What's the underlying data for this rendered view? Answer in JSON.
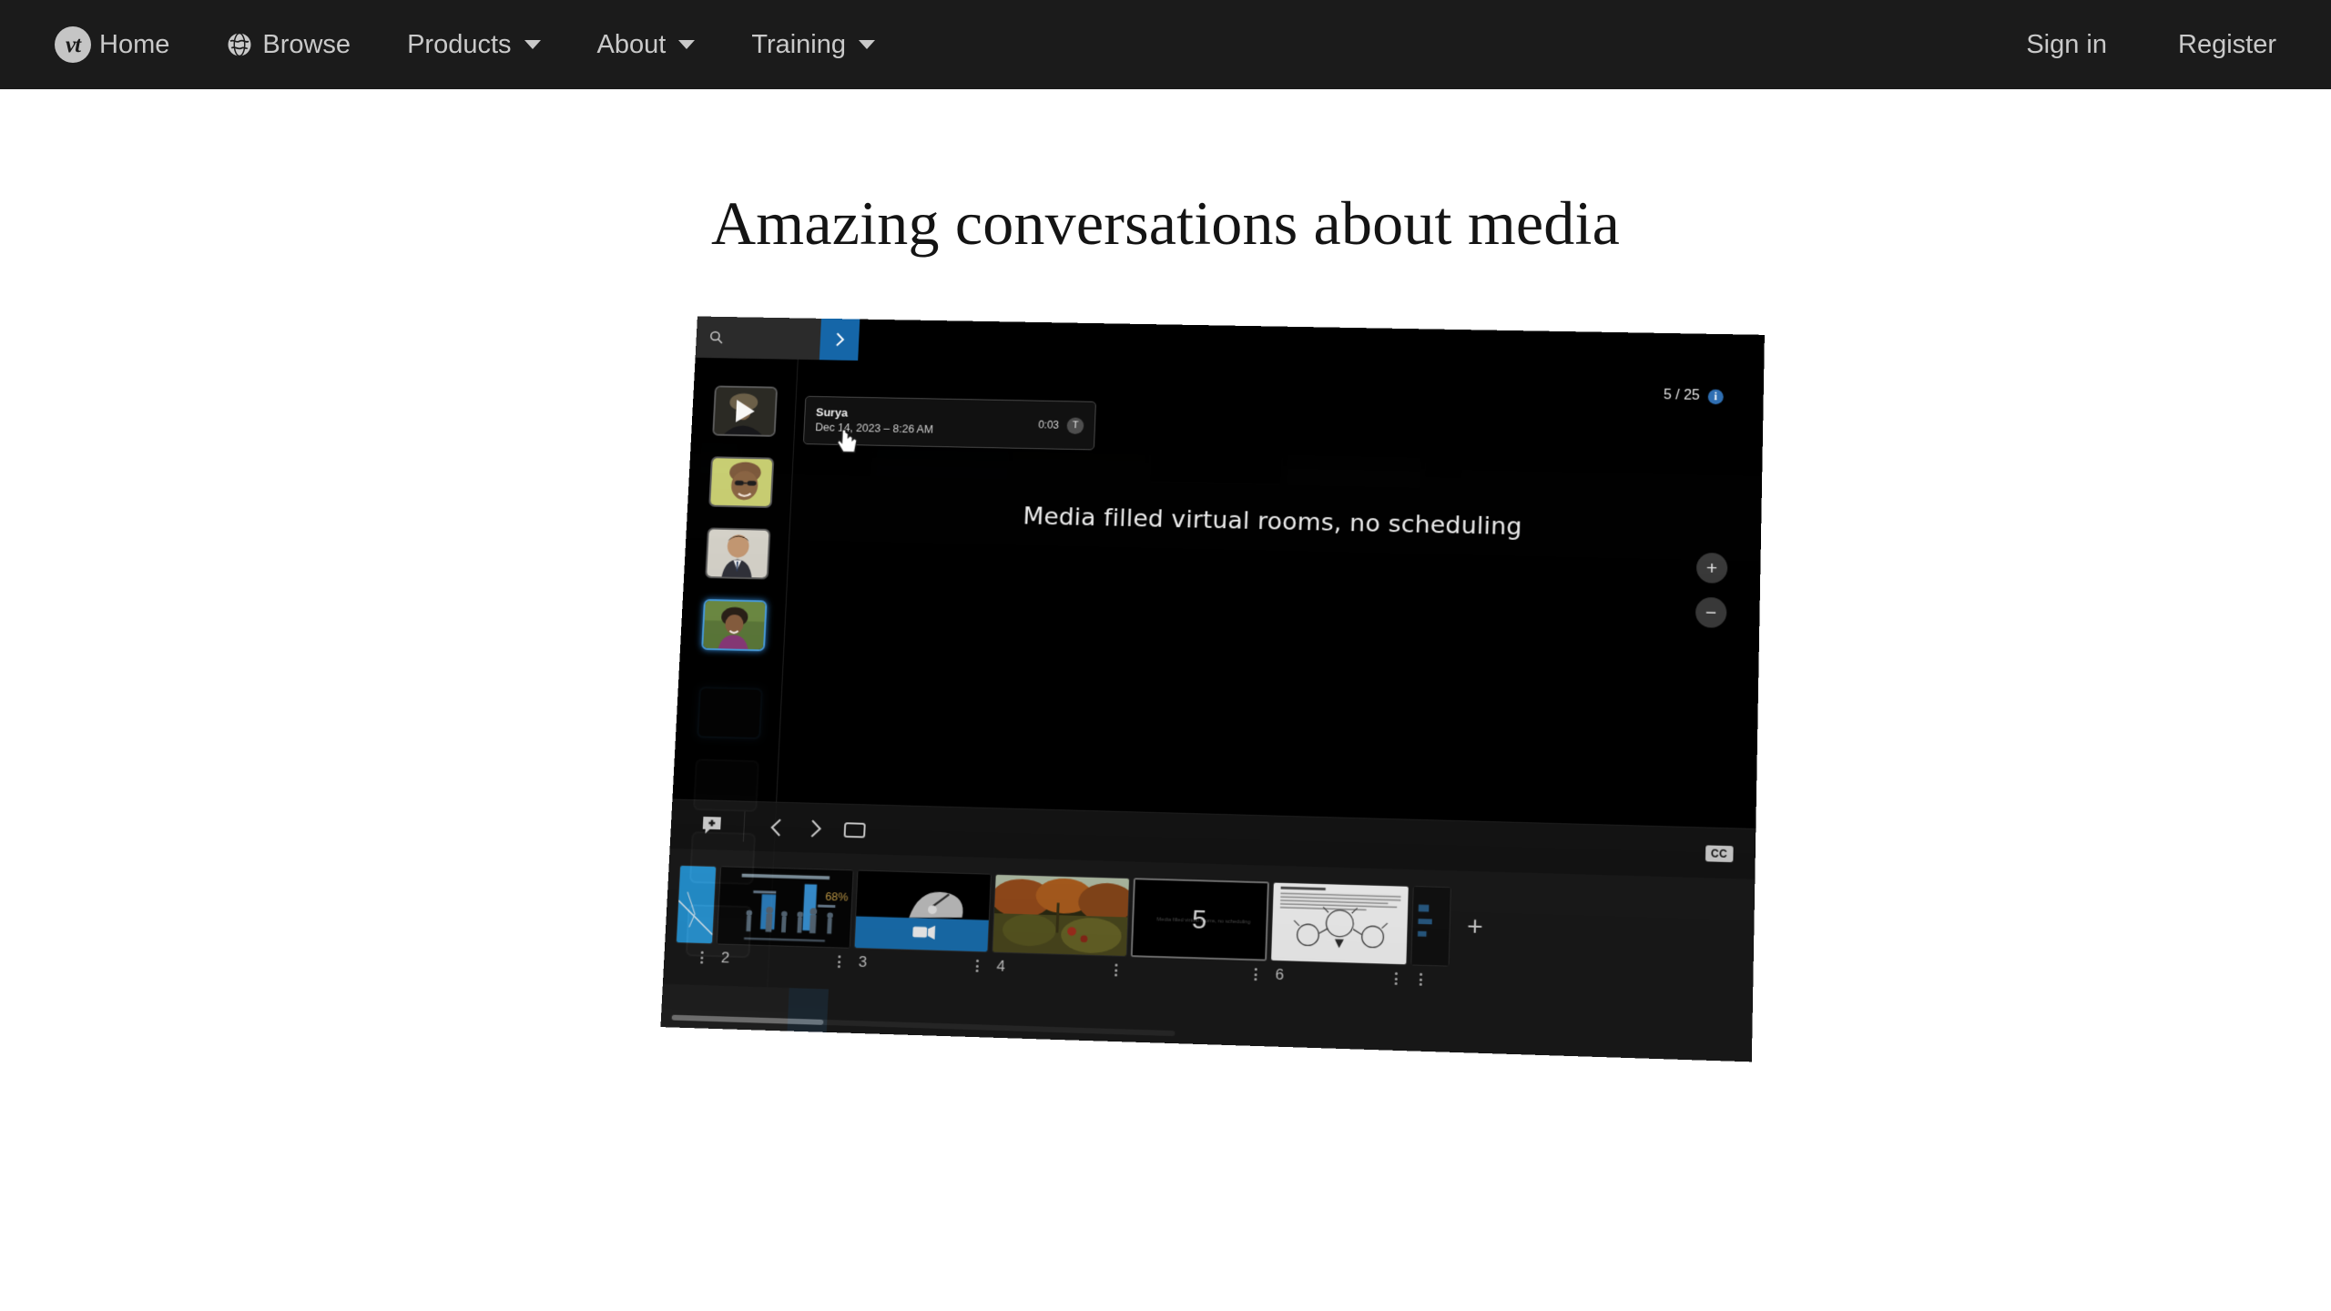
{
  "nav": {
    "logo_text": "vt",
    "left_items": [
      {
        "label": "Home",
        "icon": "vt-logo-icon",
        "caret": false
      },
      {
        "label": "Browse",
        "icon": "globe-icon",
        "caret": false
      },
      {
        "label": "Products",
        "icon": null,
        "caret": true
      },
      {
        "label": "About",
        "icon": null,
        "caret": true
      },
      {
        "label": "Training",
        "icon": null,
        "caret": true
      }
    ],
    "right_items": [
      {
        "label": "Sign in"
      },
      {
        "label": "Register"
      }
    ],
    "background_color": "#1b1b1b",
    "text_color": "#c9c9c9"
  },
  "page": {
    "headline": "Amazing conversations about media",
    "background_color": "#ffffff"
  },
  "screenshot_app": {
    "topbar": {
      "search_placeholder": "",
      "search_value": "",
      "search_icon": "search-icon",
      "panel_toggle_icon": "chevron-right-icon",
      "panel_toggle_color": "#1566a8"
    },
    "participants": [
      {
        "name": "Surya",
        "state": "playing",
        "active": false
      },
      {
        "name": "",
        "state": "idle",
        "active": false
      },
      {
        "name": "",
        "state": "idle",
        "active": false
      },
      {
        "name": "",
        "state": "idle",
        "active": true
      }
    ],
    "tooltip": {
      "name": "Surya",
      "date": "Dec 14, 2023 – 8:26 AM",
      "duration": "0:03",
      "badge_icon": "transcript-icon"
    },
    "counter": {
      "text": "5 / 25",
      "info_icon": "info-icon",
      "info_color": "#2f6fb3"
    },
    "slide": {
      "title": "Media filled virtual rooms, no scheduling"
    },
    "zoom_controls": [
      {
        "label": "+",
        "name": "zoom-in-button"
      },
      {
        "label": "−",
        "name": "zoom-out-button"
      }
    ],
    "controls": {
      "add_comment_icon": "add-comment-icon",
      "prev_icon": "chevron-left-icon",
      "next_icon": "chevron-right-icon",
      "fullscreen_icon": "fullscreen-icon",
      "cc_label": "CC"
    },
    "filmstrip": {
      "slides": [
        {
          "number": "",
          "kind": "narrow-blue",
          "current": false
        },
        {
          "number": "2",
          "kind": "chart-dark",
          "current": false
        },
        {
          "number": "3",
          "kind": "video-hand",
          "current": false
        },
        {
          "number": "4",
          "kind": "photo-orchard",
          "current": false
        },
        {
          "number": "5",
          "kind": "title-dark",
          "current": true,
          "overlay_text": "Media filled virtual rooms, no scheduling"
        },
        {
          "number": "6",
          "kind": "document-diagram",
          "current": false
        }
      ],
      "add_button_label": "+"
    }
  }
}
